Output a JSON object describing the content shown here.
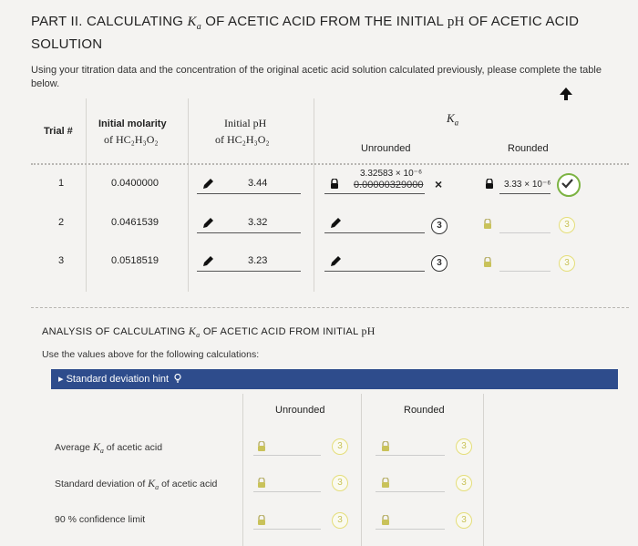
{
  "title": {
    "part1": "PART II. CALCULATING ",
    "k": "K",
    "a": "a",
    "part2": " OF ACETIC ACID FROM THE INITIAL ",
    "ph": "pH",
    "part3": " OF ACETIC ACID",
    "line2": "SOLUTION"
  },
  "intro": "Using your titration data and the concentration of the original acetic acid solution calculated previously, please complete the table below.",
  "table": {
    "headers": {
      "trial": "Trial #",
      "molarity_line1": "Initial molarity",
      "molarity_line2": "of HC₂H₃O₂",
      "ph_line1": "Initial pH",
      "ph_line2": "of HC₂H₃O₂",
      "ka": "K",
      "ka_sub": "a",
      "unrounded": "Unrounded",
      "rounded": "Rounded"
    },
    "rows": [
      {
        "trial": "1",
        "molarity": "0.0400000",
        "ph": "3.44",
        "unrounded_top": "3.32583 × 10⁻⁶",
        "unrounded_struck": "0.00000329000",
        "rounded": "3.33 × 10⁻⁶",
        "attempts_mark": "×"
      },
      {
        "trial": "2",
        "molarity": "0.0461539",
        "ph": "3.32",
        "attempts": "3",
        "rounded_attempts": "3"
      },
      {
        "trial": "3",
        "molarity": "0.0518519",
        "ph": "3.23",
        "attempts": "3",
        "rounded_attempts": "3"
      }
    ]
  },
  "analysis": {
    "heading_part1": "ANALYSIS OF CALCULATING ",
    "heading_k": "K",
    "heading_a": "a",
    "heading_part2": " OF ACETIC ACID FROM INITIAL ",
    "heading_ph": "pH",
    "instruction": "Use the values above for the following calculations:",
    "hint": "▸ Standard deviation hint",
    "col_unrounded": "Unrounded",
    "col_rounded": "Rounded",
    "rows": [
      {
        "label_a": "Average ",
        "label_k": "K",
        "label_sub": "a",
        "label_b": " of acetic acid",
        "attempts_u": "3",
        "attempts_r": "3"
      },
      {
        "label_a": "Standard deviation of ",
        "label_k": "K",
        "label_sub": "a",
        "label_b": " of acetic acid",
        "attempts_u": "3",
        "attempts_r": "3"
      },
      {
        "label_a": "90 % confidence limit",
        "label_k": "",
        "label_sub": "",
        "label_b": "",
        "attempts_u": "3",
        "attempts_r": "3"
      }
    ]
  },
  "colors": {
    "accent": "#2e4c8c",
    "correct": "#7cb342",
    "wrong": "#333333"
  }
}
